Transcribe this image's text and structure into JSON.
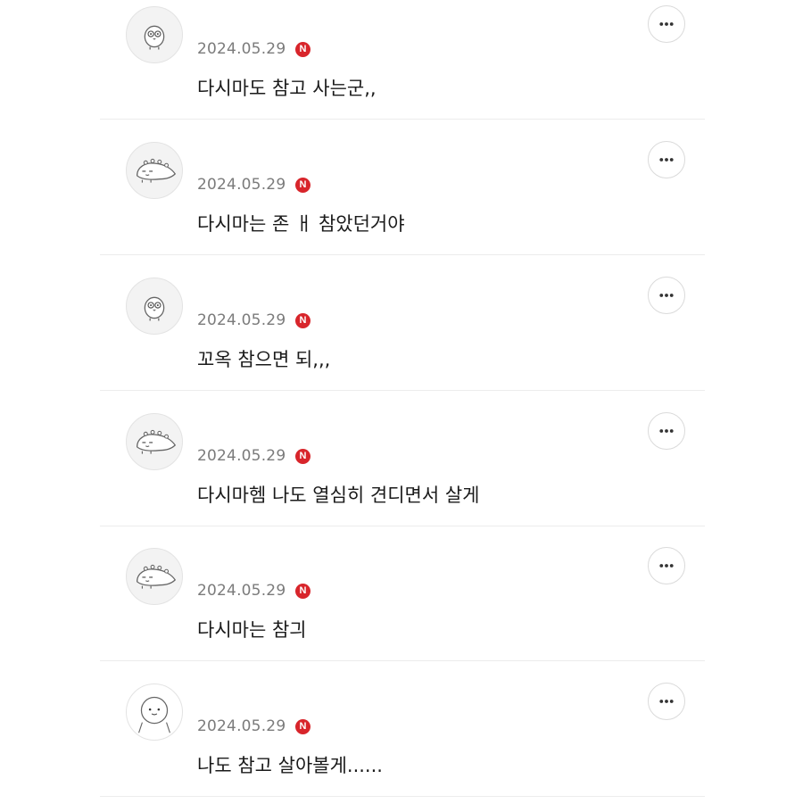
{
  "comments": [
    {
      "avatar": "bird-character-avatar",
      "date": "2024.05.29",
      "badge": "N",
      "text": "다시마도 참고 사는군,,",
      "more": "more-options"
    },
    {
      "avatar": "dinosaur-character-avatar",
      "date": "2024.05.29",
      "badge": "N",
      "text": "다시마는 존 ㅐ 참았던거야",
      "more": "more-options"
    },
    {
      "avatar": "bird-character-avatar",
      "date": "2024.05.29",
      "badge": "N",
      "text": "꼬옥 참으면 되,,,",
      "more": "more-options"
    },
    {
      "avatar": "dinosaur-character-avatar",
      "date": "2024.05.29",
      "badge": "N",
      "text": "다시마헴 나도 열심히 견디면서 살게",
      "more": "more-options"
    },
    {
      "avatar": "dinosaur-character-avatar",
      "date": "2024.05.29",
      "badge": "N",
      "text": "다시마는 참긔",
      "more": "more-options"
    },
    {
      "avatar": "round-character-avatar",
      "date": "2024.05.29",
      "badge": "N",
      "text": "나도 참고 살아볼게......",
      "more": "more-options"
    }
  ],
  "colors": {
    "badge": "#d8252b",
    "date": "#7b7b7b",
    "text": "#1a1a1a",
    "divider": "#ececec"
  }
}
